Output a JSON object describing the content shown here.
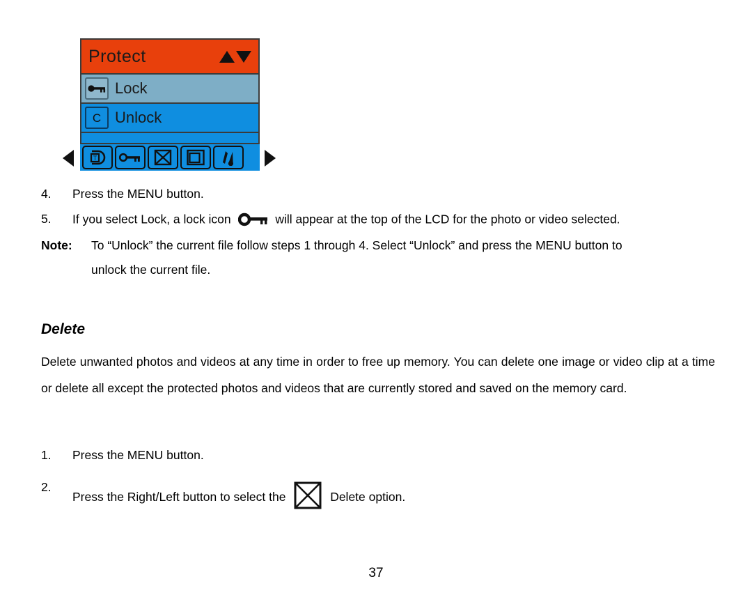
{
  "lcd": {
    "title": "Protect",
    "header_arrows": [
      "triangle-up",
      "triangle-down"
    ],
    "rows": [
      {
        "label": "Lock",
        "icon": "key-icon",
        "state": "selected"
      },
      {
        "label": "Unlock",
        "icon": "c-letter-icon",
        "state": "normal"
      }
    ],
    "toolbar_icons": [
      "thumbnail-rotate-icon",
      "key-icon",
      "delete-cross-box-icon",
      "resize-frame-icon",
      "effects-brush-icon"
    ],
    "nav_left": "left-triangle",
    "nav_right": "right-triangle",
    "colors": {
      "header_bg": "#e8400c",
      "selected_row_bg": "#7eaec6",
      "row_bg": "#0f8ee0",
      "border": "#3b3b3b"
    }
  },
  "steps_protect": [
    {
      "num": "4.",
      "text": "Press the MENU button."
    }
  ],
  "step5": {
    "num": "5.",
    "text_before": "If you select Lock, a lock icon",
    "icon": "key-icon",
    "text_after": "will appear at the top of the LCD for the photo or video selected."
  },
  "note": {
    "label": "Note:",
    "line1": "To “Unlock” the current file follow steps 1 through 4. Select “Unlock” and press the MENU button to",
    "line2": "unlock the current file."
  },
  "delete_section": {
    "heading": "Delete",
    "paragraph": "Delete unwanted photos and videos at any time in order to free up memory. You can delete one image or video clip at a time or delete all except the protected photos and videos that are currently stored and saved on the memory card.",
    "steps": [
      {
        "num": "1.",
        "text": "Press the MENU button."
      }
    ],
    "step2": {
      "num": "2.",
      "text_before": "Press the Right/Left button to select the",
      "icon": "delete-cross-box-icon",
      "text_after": "Delete option."
    }
  },
  "page_number": "37"
}
